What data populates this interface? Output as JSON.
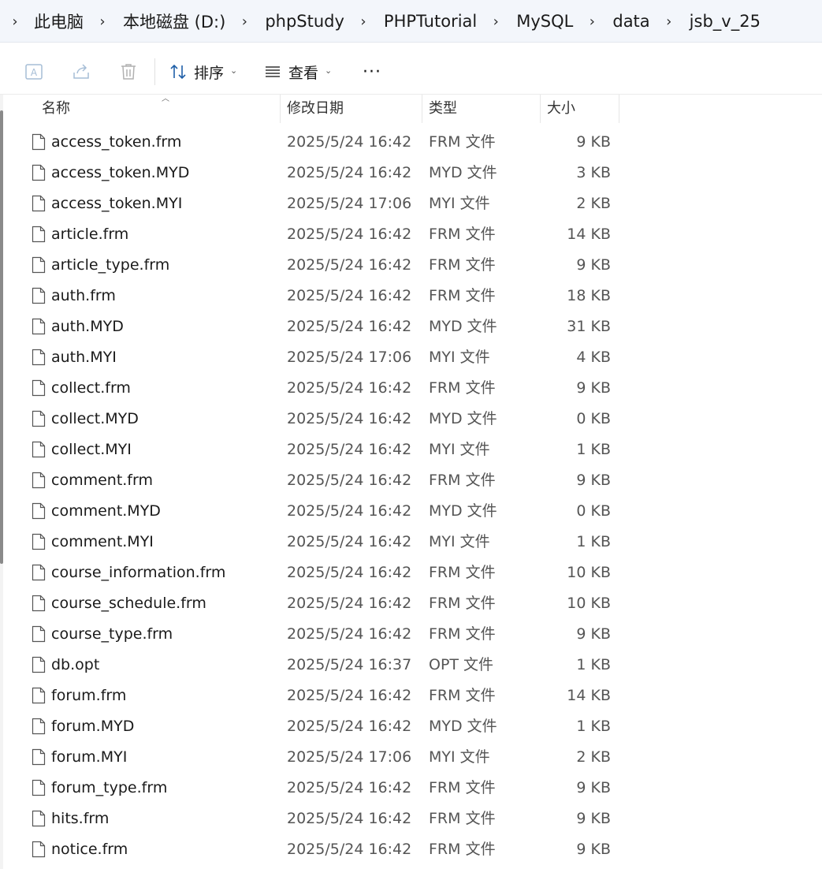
{
  "breadcrumb": [
    "此电脑",
    "本地磁盘 (D:)",
    "phpStudy",
    "PHPTutorial",
    "MySQL",
    "data",
    "jsb_v_25"
  ],
  "toolbar": {
    "sort_label": "排序",
    "view_label": "查看",
    "more_label": "···",
    "icons": [
      "rename-icon",
      "share-icon",
      "delete-icon",
      "sort-icon",
      "view-icon"
    ]
  },
  "columns": {
    "name": "名称",
    "date": "修改日期",
    "type": "类型",
    "size": "大小"
  },
  "files": [
    {
      "name": "access_token.frm",
      "date": "2025/5/24 16:42",
      "type": "FRM 文件",
      "size": "9 KB"
    },
    {
      "name": "access_token.MYD",
      "date": "2025/5/24 16:42",
      "type": "MYD 文件",
      "size": "3 KB"
    },
    {
      "name": "access_token.MYI",
      "date": "2025/5/24 17:06",
      "type": "MYI 文件",
      "size": "2 KB"
    },
    {
      "name": "article.frm",
      "date": "2025/5/24 16:42",
      "type": "FRM 文件",
      "size": "14 KB"
    },
    {
      "name": "article_type.frm",
      "date": "2025/5/24 16:42",
      "type": "FRM 文件",
      "size": "9 KB"
    },
    {
      "name": "auth.frm",
      "date": "2025/5/24 16:42",
      "type": "FRM 文件",
      "size": "18 KB"
    },
    {
      "name": "auth.MYD",
      "date": "2025/5/24 16:42",
      "type": "MYD 文件",
      "size": "31 KB"
    },
    {
      "name": "auth.MYI",
      "date": "2025/5/24 17:06",
      "type": "MYI 文件",
      "size": "4 KB"
    },
    {
      "name": "collect.frm",
      "date": "2025/5/24 16:42",
      "type": "FRM 文件",
      "size": "9 KB"
    },
    {
      "name": "collect.MYD",
      "date": "2025/5/24 16:42",
      "type": "MYD 文件",
      "size": "0 KB"
    },
    {
      "name": "collect.MYI",
      "date": "2025/5/24 16:42",
      "type": "MYI 文件",
      "size": "1 KB"
    },
    {
      "name": "comment.frm",
      "date": "2025/5/24 16:42",
      "type": "FRM 文件",
      "size": "9 KB"
    },
    {
      "name": "comment.MYD",
      "date": "2025/5/24 16:42",
      "type": "MYD 文件",
      "size": "0 KB"
    },
    {
      "name": "comment.MYI",
      "date": "2025/5/24 16:42",
      "type": "MYI 文件",
      "size": "1 KB"
    },
    {
      "name": "course_information.frm",
      "date": "2025/5/24 16:42",
      "type": "FRM 文件",
      "size": "10 KB"
    },
    {
      "name": "course_schedule.frm",
      "date": "2025/5/24 16:42",
      "type": "FRM 文件",
      "size": "10 KB"
    },
    {
      "name": "course_type.frm",
      "date": "2025/5/24 16:42",
      "type": "FRM 文件",
      "size": "9 KB"
    },
    {
      "name": "db.opt",
      "date": "2025/5/24 16:37",
      "type": "OPT 文件",
      "size": "1 KB"
    },
    {
      "name": "forum.frm",
      "date": "2025/5/24 16:42",
      "type": "FRM 文件",
      "size": "14 KB"
    },
    {
      "name": "forum.MYD",
      "date": "2025/5/24 16:42",
      "type": "MYD 文件",
      "size": "1 KB"
    },
    {
      "name": "forum.MYI",
      "date": "2025/5/24 17:06",
      "type": "MYI 文件",
      "size": "2 KB"
    },
    {
      "name": "forum_type.frm",
      "date": "2025/5/24 16:42",
      "type": "FRM 文件",
      "size": "9 KB"
    },
    {
      "name": "hits.frm",
      "date": "2025/5/24 16:42",
      "type": "FRM 文件",
      "size": "9 KB"
    },
    {
      "name": "notice.frm",
      "date": "2025/5/24 16:42",
      "type": "FRM 文件",
      "size": "9 KB"
    }
  ]
}
